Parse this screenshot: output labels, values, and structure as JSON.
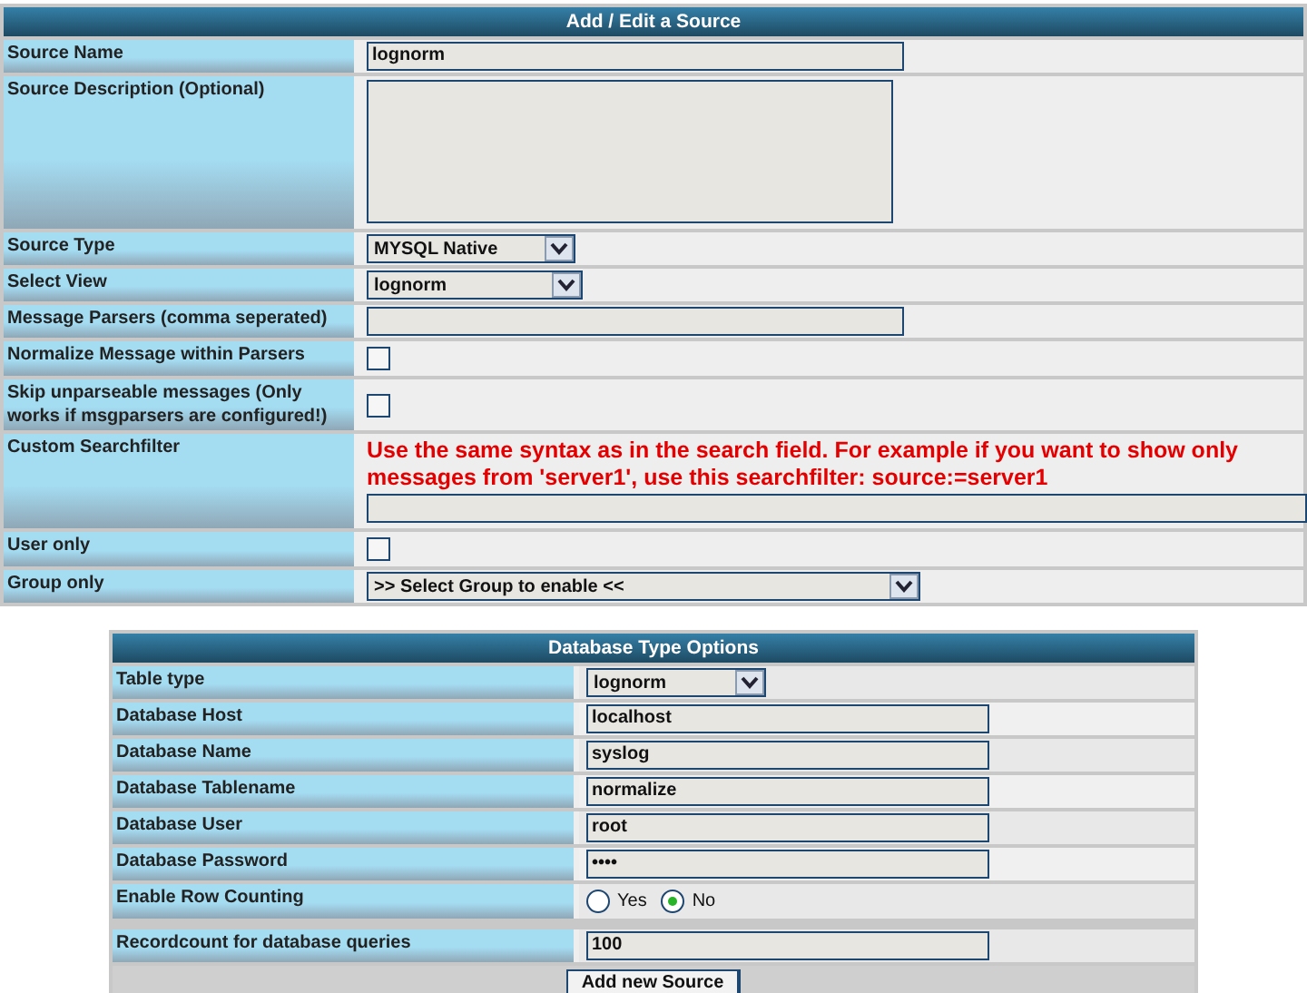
{
  "main": {
    "title": "Add / Edit a Source",
    "rows": [
      {
        "kind": "text",
        "label": "Source Name",
        "value": "lognorm"
      },
      {
        "kind": "textarea",
        "label": "Source Description (Optional)"
      },
      {
        "kind": "select",
        "label": "Source Type",
        "value": "MYSQL Native"
      },
      {
        "kind": "select",
        "label": "Select View",
        "value": "lognorm"
      },
      {
        "kind": "text",
        "label": "Message Parsers (comma seperated)"
      },
      {
        "kind": "checkbox",
        "label": "Normalize Message within Parsers",
        "checked": false
      },
      {
        "kind": "checkbox",
        "label": "Skip unparseable messages (Only works if msgparsers are configured!)",
        "checked": false
      },
      {
        "kind": "filter",
        "label": "Custom Searchfilter",
        "hint": "Use the same syntax as in the search field. For example if you want to show only messages from 'server1', use this searchfilter: source:=server1"
      },
      {
        "kind": "checkbox",
        "label": "User only",
        "checked": false
      },
      {
        "kind": "select",
        "label": "Group only",
        "value": ">> Select Group to enable <<"
      }
    ]
  },
  "database": {
    "title": "Database Type Options",
    "rows": [
      {
        "kind": "select",
        "label": "Table type",
        "value": "lognorm"
      },
      {
        "kind": "text",
        "label": "Database Host",
        "value": "localhost"
      },
      {
        "kind": "text",
        "label": "Database Name",
        "value": "syslog"
      },
      {
        "kind": "text",
        "label": "Database Tablename",
        "value": "normalize"
      },
      {
        "kind": "text",
        "label": "Database User",
        "value": "root"
      },
      {
        "kind": "password",
        "label": "Database Password",
        "value": "••••"
      },
      {
        "kind": "radio",
        "label": "Enable Row Counting",
        "options": [
          {
            "label": "Yes",
            "selected": false
          },
          {
            "label": "No",
            "selected": true
          }
        ]
      }
    ],
    "recordcount": {
      "label": "Recordcount for database queries",
      "value": "100"
    },
    "submit": "Add new Source"
  }
}
